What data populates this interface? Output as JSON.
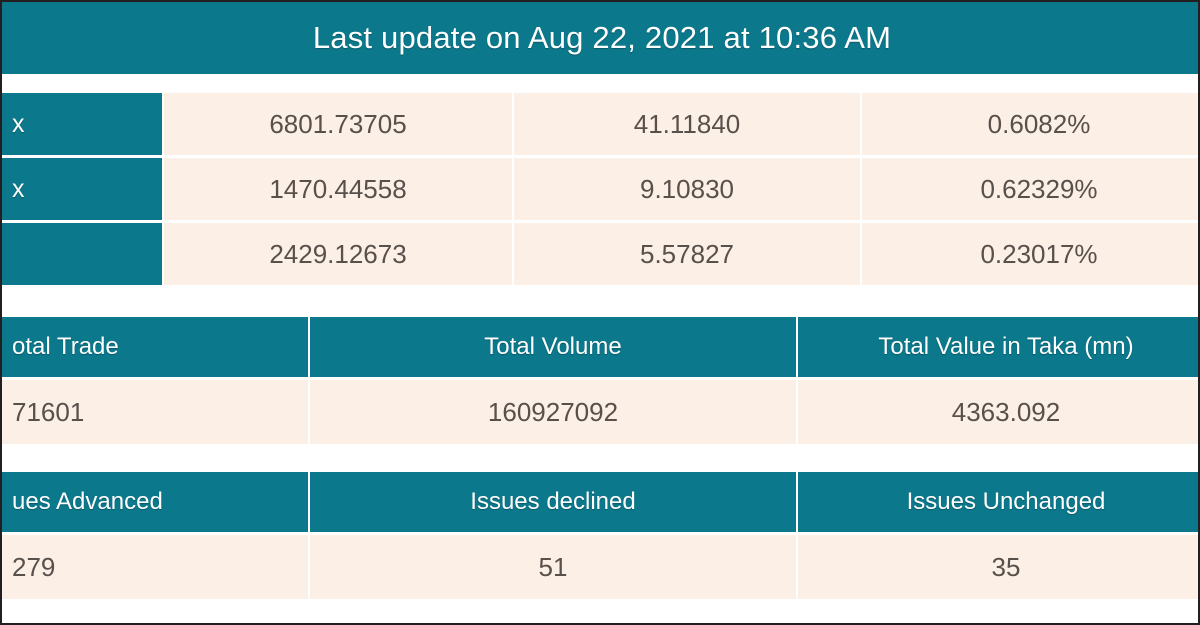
{
  "header": {
    "title": "Last update on Aug 22, 2021 at 10:36 AM",
    "background_color": "#0b788c",
    "text_color": "#ffffff"
  },
  "colors": {
    "teal": "#0b788c",
    "cream": "#fcefe6",
    "value_text": "#58504a",
    "page_border": "#231f20"
  },
  "index_table": {
    "rows": [
      {
        "label": "x",
        "index": "6801.73705",
        "change": "41.11840",
        "percent": "0.6082%"
      },
      {
        "label": "x",
        "index": "1470.44558",
        "change": "9.10830",
        "percent": "0.62329%"
      },
      {
        "label": "",
        "index": "2429.12673",
        "change": "5.57827",
        "percent": "0.23017%"
      }
    ]
  },
  "summary_table": {
    "headers": {
      "total_trade": "otal Trade",
      "total_volume": "Total Volume",
      "total_value": "Total Value in Taka (mn)"
    },
    "values": {
      "total_trade": "71601",
      "total_volume": "160927092",
      "total_value": "4363.092"
    }
  },
  "issues_table": {
    "headers": {
      "advanced": "ues Advanced",
      "declined": "Issues declined",
      "unchanged": "Issues Unchanged"
    },
    "values": {
      "advanced": "279",
      "declined": "51",
      "unchanged": "35"
    }
  }
}
